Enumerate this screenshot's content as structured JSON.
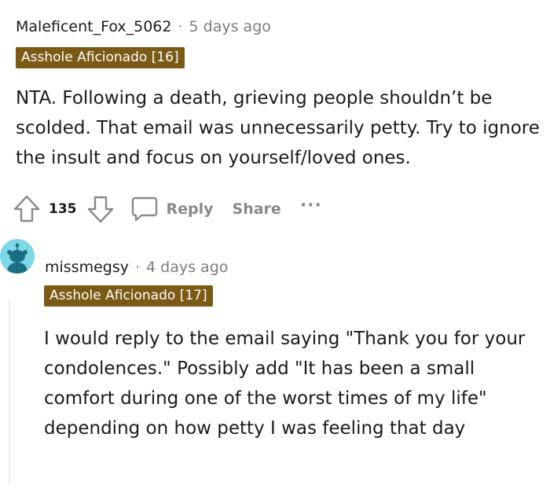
{
  "comments": [
    {
      "username": "Maleficent_Fox_5062",
      "separator": "·",
      "timestamp": "5 days ago",
      "flair": "Asshole Aficionado [16]",
      "body": "NTA. Following a death, grieving people shouldn’t be scolded. That email was unnecessarily petty. Try to ignore the insult and focus on yourself/loved ones.",
      "vote_count": "135",
      "reply_label": "Reply",
      "share_label": "Share",
      "more_label": "···"
    },
    {
      "username": "missmegsy",
      "separator": "·",
      "timestamp": "4 days ago",
      "flair": "Asshole Aficionado [17]",
      "body": "I would reply to the email saying \"Thank you for your condolences.\" Possibly add \"It has been a small comfort during one of the worst times of my life\" depending on how petty I was feeling that day"
    }
  ],
  "icons": {
    "upvote": "upvote-arrow-icon",
    "downvote": "downvote-arrow-icon",
    "reply": "speech-bubble-icon",
    "avatar": "snoo-avatar"
  },
  "colors": {
    "flair_bg": "#7a5a14",
    "avatar_bg": "#7fd8e8",
    "muted": "#878a8c"
  }
}
